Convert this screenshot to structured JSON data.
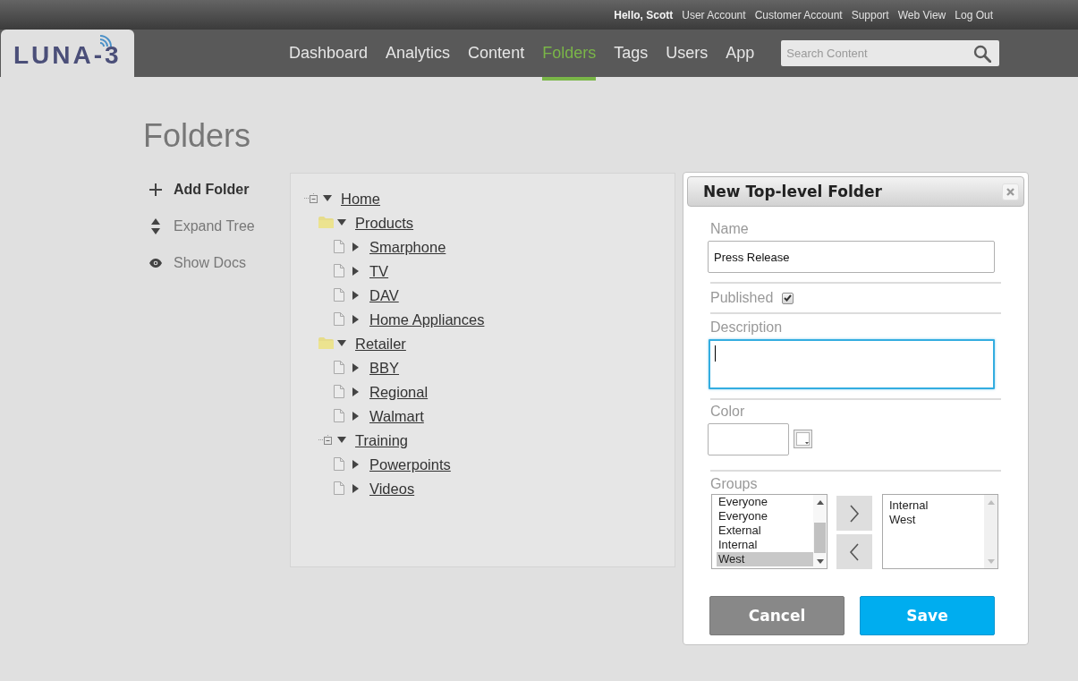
{
  "top_bar": {
    "greeting": "Hello, Scott",
    "links": [
      "User Account",
      "Customer Account",
      "Support",
      "Web View",
      "Log Out"
    ]
  },
  "nav": {
    "logo": "LUNA-3",
    "items": [
      {
        "label": "Dashboard",
        "selected": false
      },
      {
        "label": "Analytics",
        "selected": false
      },
      {
        "label": "Content",
        "selected": false
      },
      {
        "label": "Folders",
        "selected": true
      },
      {
        "label": "Tags",
        "selected": false
      },
      {
        "label": "Users",
        "selected": false
      },
      {
        "label": "App",
        "selected": false
      }
    ],
    "search": {
      "placeholder": "Search Content"
    }
  },
  "page": {
    "title": "Folders"
  },
  "actions": [
    {
      "kind": "add",
      "label": "Add Folder"
    },
    {
      "kind": "expand",
      "label": "Expand Tree"
    },
    {
      "kind": "show",
      "label": "Show Docs"
    }
  ],
  "tree": [
    {
      "label": "Home",
      "kind": "toggle",
      "expanded": true,
      "children": [
        {
          "label": "Products",
          "kind": "folder",
          "expanded": true,
          "children": [
            {
              "label": "Smarphone",
              "kind": "document",
              "expanded": false
            },
            {
              "label": "TV",
              "kind": "document",
              "expanded": false
            },
            {
              "label": "DAV",
              "kind": "document",
              "expanded": false
            },
            {
              "label": "Home Appliances",
              "kind": "document",
              "expanded": false
            }
          ]
        },
        {
          "label": "Retailer",
          "kind": "folder",
          "expanded": true,
          "children": [
            {
              "label": "BBY",
              "kind": "document",
              "expanded": false
            },
            {
              "label": "Regional",
              "kind": "document",
              "expanded": false
            },
            {
              "label": "Walmart",
              "kind": "document",
              "expanded": false
            }
          ]
        },
        {
          "label": "Training",
          "kind": "toggle",
          "expanded": true,
          "children": [
            {
              "label": "Powerpoints",
              "kind": "document",
              "expanded": false
            },
            {
              "label": "Videos",
              "kind": "document",
              "expanded": false
            }
          ]
        }
      ]
    }
  ],
  "dialog": {
    "title": "New Top-level Folder",
    "name": {
      "label": "Name",
      "value": "Press Release"
    },
    "published": {
      "label": "Published",
      "checked": true
    },
    "description": {
      "label": "Description",
      "focused": true
    },
    "color": {
      "label": "Color"
    },
    "groups": {
      "label": "Groups",
      "available": [
        {
          "label": "Everyone",
          "selected": false
        },
        {
          "label": "Everyone",
          "selected": false
        },
        {
          "label": "External",
          "selected": false
        },
        {
          "label": "Internal",
          "selected": false
        },
        {
          "label": "West",
          "selected": true
        }
      ],
      "assigned": [
        {
          "label": "Internal",
          "selected": false
        },
        {
          "label": "West",
          "selected": false
        }
      ]
    },
    "buttons": [
      {
        "kind": "cancel",
        "label": "Cancel"
      },
      {
        "kind": "save",
        "label": "Save"
      }
    ]
  }
}
